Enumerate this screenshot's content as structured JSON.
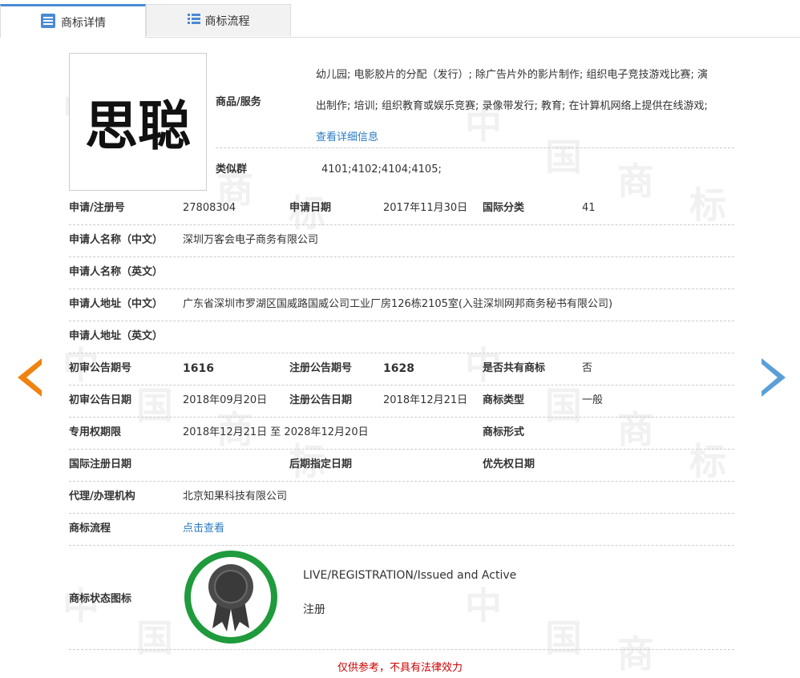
{
  "tabs": [
    {
      "label": "商标详情",
      "icon": "list-detail-icon"
    },
    {
      "label": "商标流程",
      "icon": "list-grid-icon"
    }
  ],
  "watermark": [
    "中",
    "国",
    "商",
    "标"
  ],
  "trademark": {
    "logo_text": "思聪",
    "goods_label": "商品/服务",
    "goods_line1": "幼儿园; 电影胶片的分配（发行）; 除广告片外的影片制作; 组织电子竞技游戏比赛; 演",
    "goods_line2": "出制作; 培训; 组织教育或娱乐竞赛; 录像带发行; 教育; 在计算机网络上提供在线游戏;",
    "goods_link": "查看详细信息",
    "similar_label": "类似群",
    "similar_value": "4101;4102;4104;4105;"
  },
  "rows": {
    "reg_no_label": "申请/注册号",
    "reg_no": "27808304",
    "apply_date_label": "申请日期",
    "apply_date": "2017年11月30日",
    "intl_class_label": "国际分类",
    "intl_class": "41",
    "applicant_cn_label": "申请人名称（中文）",
    "applicant_cn": "深圳万客会电子商务有限公司",
    "applicant_en_label": "申请人名称（英文）",
    "applicant_en": "",
    "address_cn_label": "申请人地址（中文）",
    "address_cn": "广东省深圳市罗湖区国威路国威公司工业厂房126栋2105室(入驻深圳网邦商务秘书有限公司)",
    "address_en_label": "申请人地址（英文）",
    "address_en": "",
    "prelim_no_label": "初审公告期号",
    "prelim_no": "1616",
    "reg_pub_no_label": "注册公告期号",
    "reg_pub_no": "1628",
    "shared_label": "是否共有商标",
    "shared": "否",
    "prelim_date_label": "初审公告日期",
    "prelim_date": "2018年09月20日",
    "reg_pub_date_label": "注册公告日期",
    "reg_pub_date": "2018年12月21日",
    "type_label": "商标类型",
    "type": "一般",
    "period_label": "专用权期限",
    "period": "2018年12月21日 至 2028年12月20日",
    "form_label": "商标形式",
    "form": "",
    "intl_reg_date_label": "国际注册日期",
    "intl_reg_date": "",
    "later_date_label": "后期指定日期",
    "later_date": "",
    "priority_label": "优先权日期",
    "priority": "",
    "agent_label": "代理/办理机构",
    "agent": "北京知果科技有限公司",
    "flow_label": "商标流程",
    "flow_link": "点击查看",
    "status_label": "商标状态图标",
    "status_en": "LIVE/REGISTRATION/Issued and Active",
    "status_cn": "注册"
  },
  "footer": "仅供参考，不具有法律效力",
  "colors": {
    "accent": "#4a8ad4",
    "link": "#2a7bc4",
    "arrow_left": "#f0820f",
    "arrow_right": "#5a9fd8",
    "badge_ring": "#1f9a3c",
    "footer": "#cc0000"
  }
}
